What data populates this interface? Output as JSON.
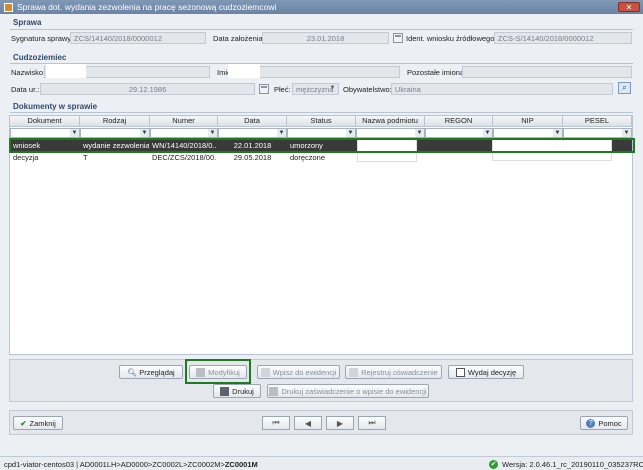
{
  "window": {
    "title": "Sprawa dot. wydania zezwolenia na pracę sezonową cudzoziemcowi",
    "close_label": "✕"
  },
  "sprawa": {
    "section_title": "Sprawa",
    "sygnatura_label": "Sygnatura sprawy:",
    "sygnatura_value": "ZCS/14140/2018/0000012",
    "data_zalozenia_label": "Data założenia:",
    "data_zalozenia_value": "23.01.2018",
    "ident_label": "Ident. wniosku źródłowego:",
    "ident_value": "ZCS-S/14140/2018/0000012"
  },
  "cudzoziemiec": {
    "section_title": "Cudzoziemiec",
    "nazwisko_label": "Nazwisko:",
    "imie_label": "Imię",
    "pozostale_label": "Pozostałe imiona:",
    "data_ur_label": "Data ur.:",
    "data_ur_value": "29.12.1986",
    "plec_label": "Płeć:",
    "plec_value": "mężczyzna",
    "obywatelstwo_label": "Obywatelstwo:",
    "obywatelstwo_value": "Ukraina"
  },
  "dokumenty": {
    "section_title": "Dokumenty w sprawie",
    "columns": [
      "Dokument",
      "Rodzaj",
      "Numer",
      "Data",
      "Status",
      "Nazwa podmiotu",
      "REGON",
      "NIP",
      "PESEL"
    ],
    "rows": [
      {
        "dokument": "wniosek",
        "rodzaj": "wydanie zezwolenia",
        "numer": "WN/14140/2018/0...",
        "data": "22.01.2018",
        "status": "umorzony"
      },
      {
        "dokument": "decyzja",
        "rodzaj": "T",
        "numer": "DEC/ZCS/2018/00...",
        "data": "29.05.2018",
        "status": "doręczone"
      }
    ]
  },
  "actions": {
    "przegladaj": "Przeglądaj",
    "modyfikuj": "Modyfikuj",
    "wpisz": "Wpisz do ewidencji",
    "rejestruj": "Rejestruj oświadczenie",
    "wydaj": "Wydaj decyzję",
    "drukuj": "Drukuj",
    "drukuj_zasw": "Drukuj zaświadczenie o wpisie do ewidencji"
  },
  "footer": {
    "zamknij": "Zamknij",
    "pomoc": "Pomoc"
  },
  "statusbar": {
    "path": "cpd1-viator-centos03 | AD0001LH>AD0000>ZC0002L>ZC0002M>",
    "path_bold": "ZC0001M",
    "version": "Wersja: 2.0.46.1_rc_20190110_035237RC"
  },
  "colors": {
    "highlight": "#1f7a1f",
    "selected_row": "#3a3a3a",
    "title_bar": "#7f98b6"
  }
}
